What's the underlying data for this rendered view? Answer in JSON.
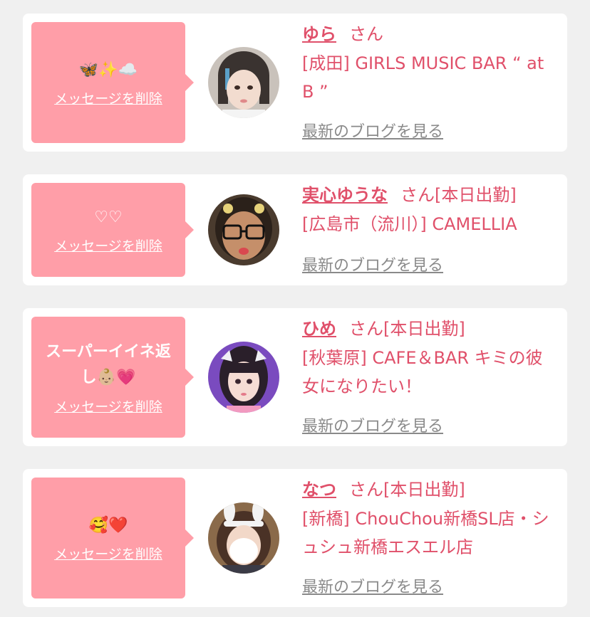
{
  "users": [
    {
      "message": "🦋✨☁️",
      "delete_label": "メッセージを削除",
      "name": "ゆら",
      "suffix": "さん",
      "shop": "[成田] GIRLS MUSIC BAR “ at B ”",
      "blog_label": "最新のブログを見る"
    },
    {
      "message": "♡♡",
      "delete_label": "メッセージを削除",
      "name": "実心ゆうな",
      "suffix": "さん[本日出勤]",
      "shop": "[広島市（流川）] CAMELLIA",
      "blog_label": "最新のブログを見る"
    },
    {
      "message": "スーパーイイネ返し👶🏼💗",
      "delete_label": "メッセージを削除",
      "name": "ひめ",
      "suffix": "さん[本日出勤]",
      "shop": "[秋葉原] CAFE＆BAR キミの彼女になりたい！",
      "blog_label": "最新のブログを見る"
    },
    {
      "message": "🥰❤️",
      "delete_label": "メッセージを削除",
      "name": "なつ",
      "suffix": "さん[本日出勤]",
      "shop": "[新橋] ChouChou新橋SL店・シュシュ新橋エスエル店",
      "blog_label": "最新のブログを見る"
    }
  ],
  "colors": {
    "accent": "#e0506a",
    "bubble": "#ff9ea8",
    "link_gray": "#8a8a8a",
    "background": "#f0f0f0"
  }
}
